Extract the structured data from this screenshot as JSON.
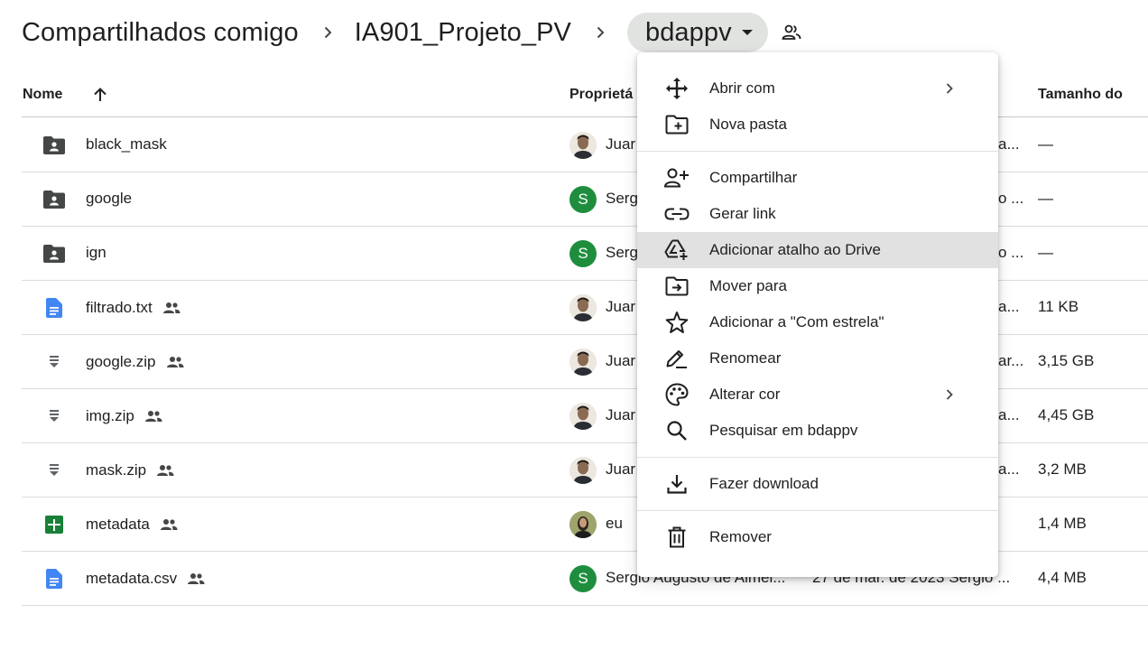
{
  "breadcrumb": {
    "items": [
      "Compartilhados comigo",
      "IA901_Projeto_PV"
    ],
    "current": "bdappv"
  },
  "table": {
    "headers": {
      "name": "Nome",
      "owner": "Proprietá",
      "size": "Tamanho do"
    },
    "rows": [
      {
        "type": "folder",
        "name": "black_mask",
        "shared": false,
        "avatar": "photo",
        "owner": "Juar",
        "tail": "a...",
        "size": "—"
      },
      {
        "type": "folder",
        "name": "google",
        "shared": false,
        "avatar": "S",
        "owner": "Serg",
        "tail": "o ...",
        "size": "—"
      },
      {
        "type": "folder",
        "name": "ign",
        "shared": false,
        "avatar": "S",
        "owner": "Serg",
        "tail": "o ...",
        "size": "—"
      },
      {
        "type": "doc",
        "name": "filtrado.txt",
        "shared": true,
        "avatar": "photo",
        "owner": "Juar",
        "tail": "a...",
        "size": "11 KB"
      },
      {
        "type": "zip",
        "name": "google.zip",
        "shared": true,
        "avatar": "photo",
        "owner": "Juar",
        "tail": "ar...",
        "size": "3,15 GB"
      },
      {
        "type": "zip",
        "name": "img.zip",
        "shared": true,
        "avatar": "photo",
        "owner": "Juar",
        "tail": "a...",
        "size": "4,45 GB"
      },
      {
        "type": "zip",
        "name": "mask.zip",
        "shared": true,
        "avatar": "photo",
        "owner": "Juar",
        "tail": "a...",
        "size": "3,2 MB"
      },
      {
        "type": "sheet",
        "name": "metadata",
        "shared": true,
        "avatar": "eu",
        "owner": "eu",
        "tail": "",
        "size": "1,4 MB"
      },
      {
        "type": "doc",
        "name": "metadata.csv",
        "shared": true,
        "avatar": "S",
        "owner": "Sergio Augusto de Almei...",
        "modified": "27 de mar. de 2023 Sergio ...",
        "tail": "",
        "size": "4,4 MB"
      }
    ]
  },
  "menu": {
    "items": [
      {
        "icon": "open-with-icon",
        "label": "Abrir com",
        "submenu": true
      },
      {
        "icon": "new-folder-icon",
        "label": "Nova pasta",
        "submenu": false
      },
      {
        "icon": "share-icon",
        "label": "Compartilhar",
        "submenu": false
      },
      {
        "icon": "link-icon",
        "label": "Gerar link",
        "submenu": false
      },
      {
        "icon": "add-shortcut-icon",
        "label": "Adicionar atalho ao Drive",
        "submenu": false
      },
      {
        "icon": "move-icon",
        "label": "Mover para",
        "submenu": false
      },
      {
        "icon": "star-icon",
        "label": "Adicionar a \"Com estrela\"",
        "submenu": false
      },
      {
        "icon": "rename-icon",
        "label": "Renomear",
        "submenu": false
      },
      {
        "icon": "palette-icon",
        "label": "Alterar cor",
        "submenu": true
      },
      {
        "icon": "search-icon",
        "label": "Pesquisar em bdappv",
        "submenu": false
      },
      {
        "icon": "download-icon",
        "label": "Fazer download",
        "submenu": false
      },
      {
        "icon": "trash-icon",
        "label": "Remover",
        "submenu": false
      }
    ]
  },
  "colors": {
    "text": "#1f1f1f",
    "folder": "#444746",
    "doc_blue": "#4285f4",
    "sheet_green": "#188038",
    "avatar_green": "#1e8e3e",
    "menu_hover": "#e1e1e1",
    "chip_bg": "#e1e3e1"
  }
}
